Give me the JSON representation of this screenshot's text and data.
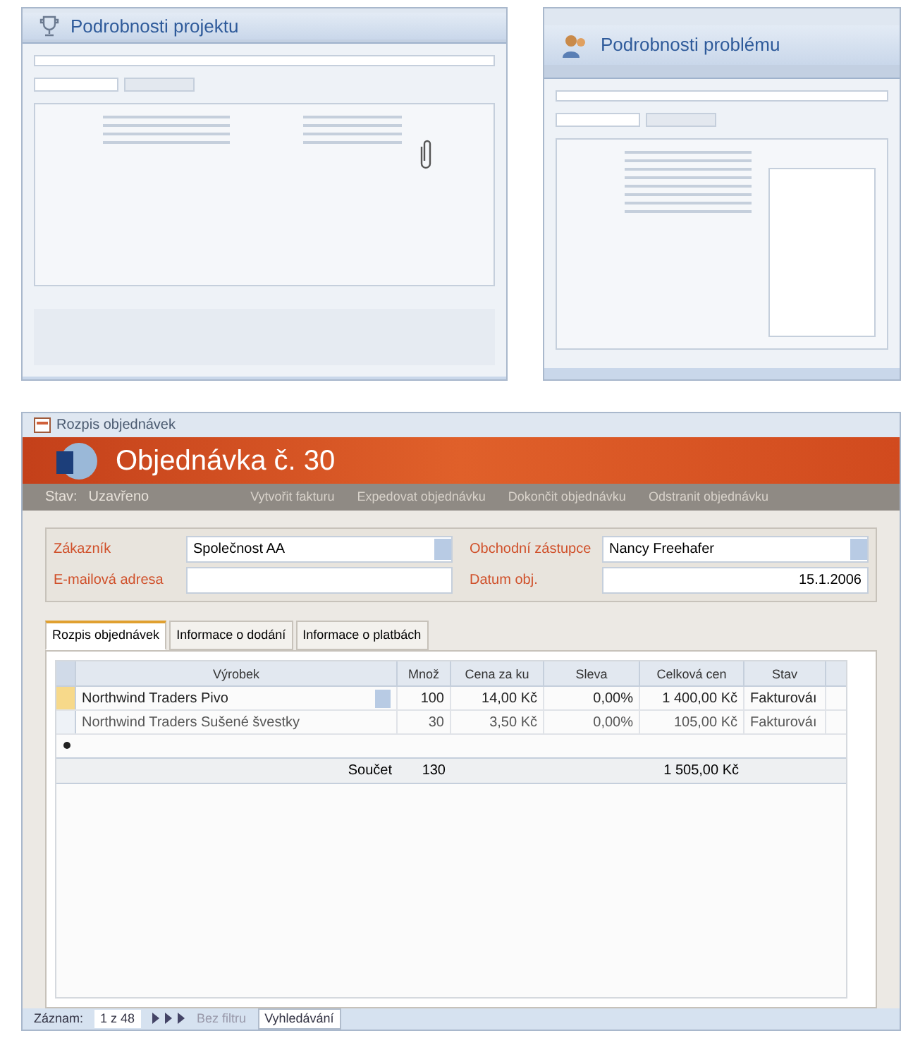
{
  "thumbnails": [
    {
      "kind": "project",
      "title": "Podrobnosti projektu"
    },
    {
      "kind": "issue",
      "title": "Podrobnosti problému"
    }
  ],
  "order_form": {
    "window_title": "Rozpis objednávek",
    "header_title": "Objednávka č. 30",
    "status_label": "Stav:",
    "status_value": "Uzavřeno",
    "actions": [
      "Vytvořit fakturu",
      "Expedovat objednávku",
      "Dokončit objednávku",
      "Odstranit objednávku"
    ],
    "fields": [
      {
        "label": "Zákazník",
        "value": "Společnost AA",
        "dropdown": true,
        "kind": "text"
      },
      {
        "label": "Obchodní zástupce",
        "value": "Nancy Freehafer",
        "dropdown": true,
        "kind": "text"
      },
      {
        "label": "E-mailová adresa",
        "dropdown": false,
        "kind": "text"
      },
      {
        "label": "Datum obj.",
        "value": "15.1.2006",
        "dropdown": false,
        "kind": "date"
      }
    ],
    "tabs": [
      {
        "label": "Rozpis objednávek",
        "selected": true
      },
      {
        "label": "Informace o dodání",
        "selected": false
      },
      {
        "label": "Informace o platbách",
        "selected": false
      }
    ],
    "table": {
      "columns": [
        "Výrobek",
        "Množ",
        "Cena za ku",
        "Sleva",
        "Celková cen",
        "Stav"
      ],
      "rows": [
        {
          "selected": true,
          "cells": [
            "Northwind Traders Pivo",
            "100",
            "14,00 Kč",
            "0,00%",
            "1 400,00 Kč",
            "Fakturováı"
          ]
        },
        {
          "selected": false,
          "cells": [
            "Northwind Traders Sušené švestky",
            "30",
            "3,50 Kč",
            "0,00%",
            "105,00 Kč",
            "Fakturováı"
          ]
        }
      ],
      "totals": {
        "label": "Součet",
        "quantity": "130",
        "amount": "1 505,00 Kč"
      }
    },
    "status_bar": {
      "record_label": "Záznam:",
      "position": "1 z 48",
      "filter": "Bez filtru",
      "search": "Vyhledávání"
    }
  }
}
